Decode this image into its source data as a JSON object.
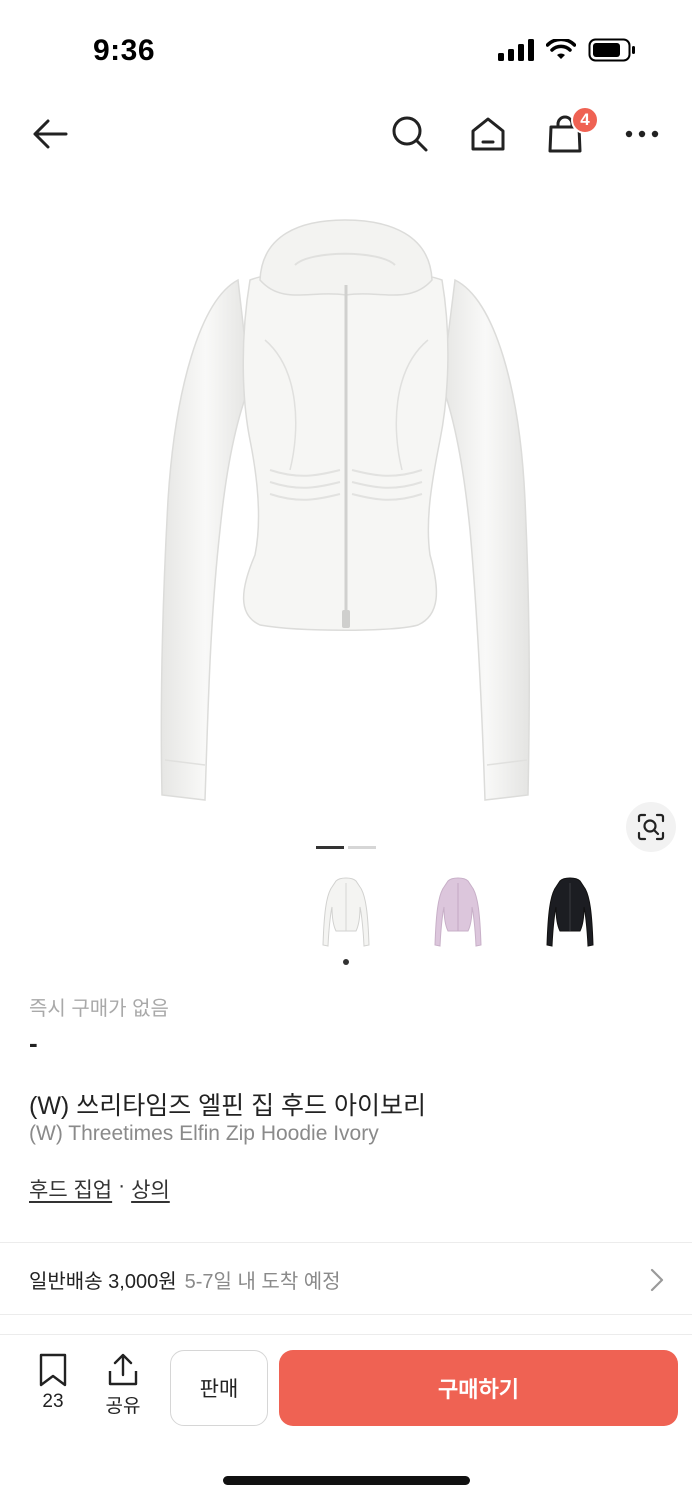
{
  "status_bar": {
    "time": "9:36"
  },
  "nav": {
    "cart_count": "4"
  },
  "colors": {
    "accent": "#ef6253",
    "muted_text": "#8a8a8a",
    "light_text": "#a9a9a9"
  },
  "gallery": {
    "page_count": 2,
    "active_page": 1
  },
  "variants": [
    {
      "name": "ivory",
      "color": "#f4f4f2"
    },
    {
      "name": "pink",
      "color": "#dcc6dc"
    },
    {
      "name": "black",
      "color": "#1c1d22"
    }
  ],
  "price": {
    "label": "즉시 구매가 없음",
    "value": "-"
  },
  "product": {
    "title_ko": "(W) 쓰리타임즈 엘핀 집 후드 아이보리",
    "title_en": "(W) Threetimes Elfin Zip Hoodie Ivory"
  },
  "category": {
    "sub": "후드 집업",
    "separator": "·",
    "main": "상의"
  },
  "shipping": {
    "label": "일반배송 3,000원",
    "eta": "5-7일 내 도착 예정"
  },
  "bottom_bar": {
    "bookmark_count": "23",
    "share_label": "공유",
    "sell_label": "판매",
    "buy_label": "구매하기"
  },
  "icons": [
    "back-arrow-icon",
    "search-icon",
    "home-icon",
    "shopping-bag-icon",
    "more-icon",
    "lens-search-icon",
    "bookmark-icon",
    "share-icon",
    "chevron-right-icon"
  ]
}
